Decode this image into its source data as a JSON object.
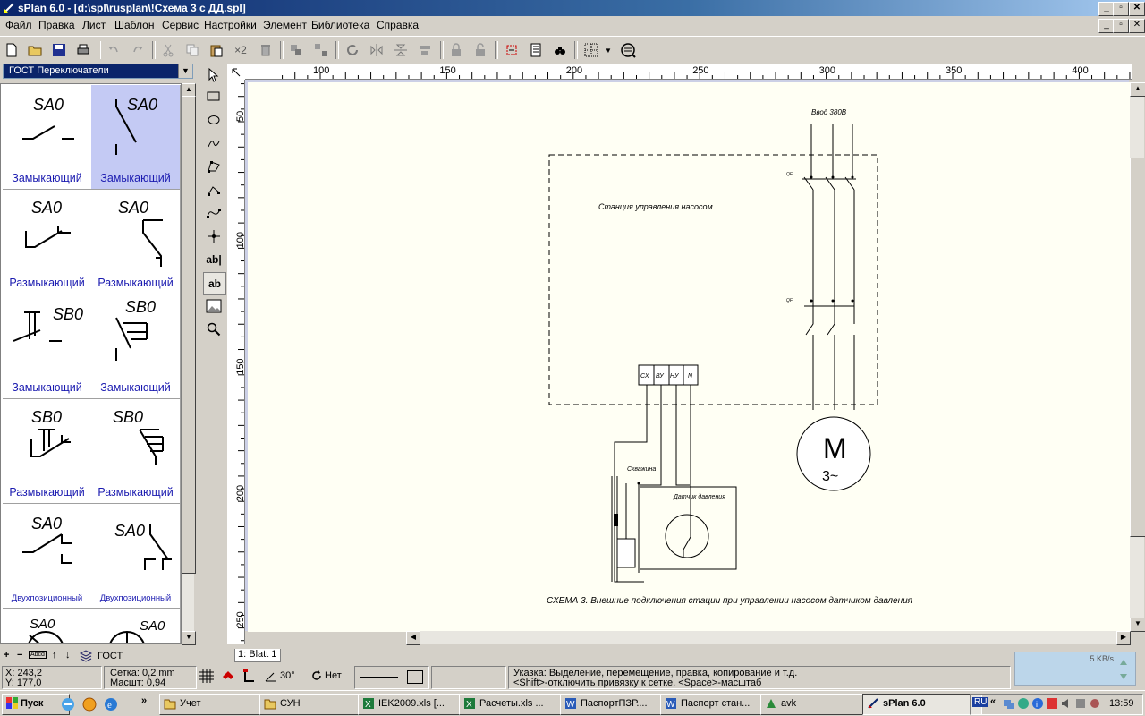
{
  "window": {
    "title": "sPlan 6.0 - [d:\\spl\\rusplan\\!Схема 3 с ДД.spl]",
    "controls": {
      "minimize": "_",
      "restore": "▫",
      "close": "✕"
    },
    "doc_controls": {
      "minimize": "_",
      "restore": "▫",
      "close": "✕"
    }
  },
  "menu": [
    "Файл",
    "Правка",
    "Лист",
    "Шаблон",
    "Сервис",
    "Настройки",
    "Элемент",
    "Библиотека",
    "Справка"
  ],
  "toolbar": {
    "zoom_factor": "×2",
    "icons": [
      "new-icon",
      "open-icon",
      "save-icon",
      "print-icon",
      "undo-icon",
      "redo-icon",
      "cut-icon",
      "copy-icon",
      "paste-icon",
      "duplicate-icon",
      "delete-icon",
      "group-icon",
      "ungroup-icon",
      "rotate-icon",
      "mirror-h-icon",
      "mirror-v-icon",
      "align-icon",
      "lock-icon",
      "unlock-icon",
      "component-icon",
      "parts-list-icon",
      "find-icon",
      "grid-icon",
      "zoom-fit-icon"
    ]
  },
  "library": {
    "selected": "ГОСТ Переключатели",
    "cells": [
      {
        "label": "Замыкающий",
        "designator": "SA0"
      },
      {
        "label": "Замыкающий",
        "designator": "SA0"
      },
      {
        "label": "Размыкающий",
        "designator": "SA0"
      },
      {
        "label": "Размыкающий",
        "designator": "SA0"
      },
      {
        "label": "Замыкающий",
        "designator": "SB0"
      },
      {
        "label": "Замыкающий",
        "designator": "SB0"
      },
      {
        "label": "Размыкающий",
        "designator": "SB0"
      },
      {
        "label": "Размыкающий",
        "designator": "SB0"
      },
      {
        "label": "Двухпозиционный",
        "designator": "SA0"
      },
      {
        "label": "Двухпозиционный",
        "designator": "SA0"
      },
      {
        "label": "",
        "designator": "SA0"
      },
      {
        "label": "",
        "designator": "SA0"
      }
    ],
    "footer_label": "ГОСТ",
    "footer_icons": [
      "+",
      "−",
      "Abcd",
      "↑",
      "↓"
    ]
  },
  "tools": {
    "text_label": "ab|",
    "text_frame_label": "ab"
  },
  "ruler": {
    "h_ticks": [
      "100",
      "150",
      "200",
      "250",
      "300",
      "350",
      "400"
    ],
    "v_ticks": [
      "50",
      "100",
      "150",
      "200",
      "250"
    ]
  },
  "drawing": {
    "input_label": "Ввод 380В",
    "station_label": "Станция управления насосом",
    "breaker_label": "QF",
    "terminals": [
      "СХ",
      "ВУ",
      "НУ",
      "N"
    ],
    "well_label": "Скважина",
    "sensor_label": "Датчик давления",
    "motor_letter": "M",
    "motor_phase": "3~",
    "caption": "СХЕМА 3. Внешние подключения стации при управлении насосом датчиком давления"
  },
  "sheet_tab": "1: Blatt 1",
  "status": {
    "x": "X: 243,2",
    "y": "Y: 177,0",
    "grid": "Сетка:  0,2 mm",
    "scale": "Масшт:  0,94",
    "angle": "30°",
    "snap": "Нет",
    "hint_line1": "Указка: Выделение, перемещение, правка, копирование и т.д.",
    "hint_line2": "<Shift>-отключить привязку к сетке, <Space>-масштаб"
  },
  "net_widget": {
    "speed": "5 KB/s"
  },
  "taskbar": {
    "start": "Пуск",
    "overflow": "»",
    "buttons": [
      {
        "label": "Учет",
        "icon": "folder-icon"
      },
      {
        "label": "СУН",
        "icon": "folder-icon"
      },
      {
        "label": "IEK2009.xls  [...",
        "icon": "excel-icon"
      },
      {
        "label": "Расчеты.xls  ...",
        "icon": "excel-icon"
      },
      {
        "label": "ПаспортПЗР....",
        "icon": "word-icon"
      },
      {
        "label": "Паспорт стан...",
        "icon": "word-icon"
      },
      {
        "label": "avk",
        "icon": "app-icon"
      },
      {
        "label": "sPlan 6.0",
        "icon": "splan-icon"
      }
    ],
    "lang": "RU",
    "tray_chevron": "«",
    "clock": "13:59"
  }
}
